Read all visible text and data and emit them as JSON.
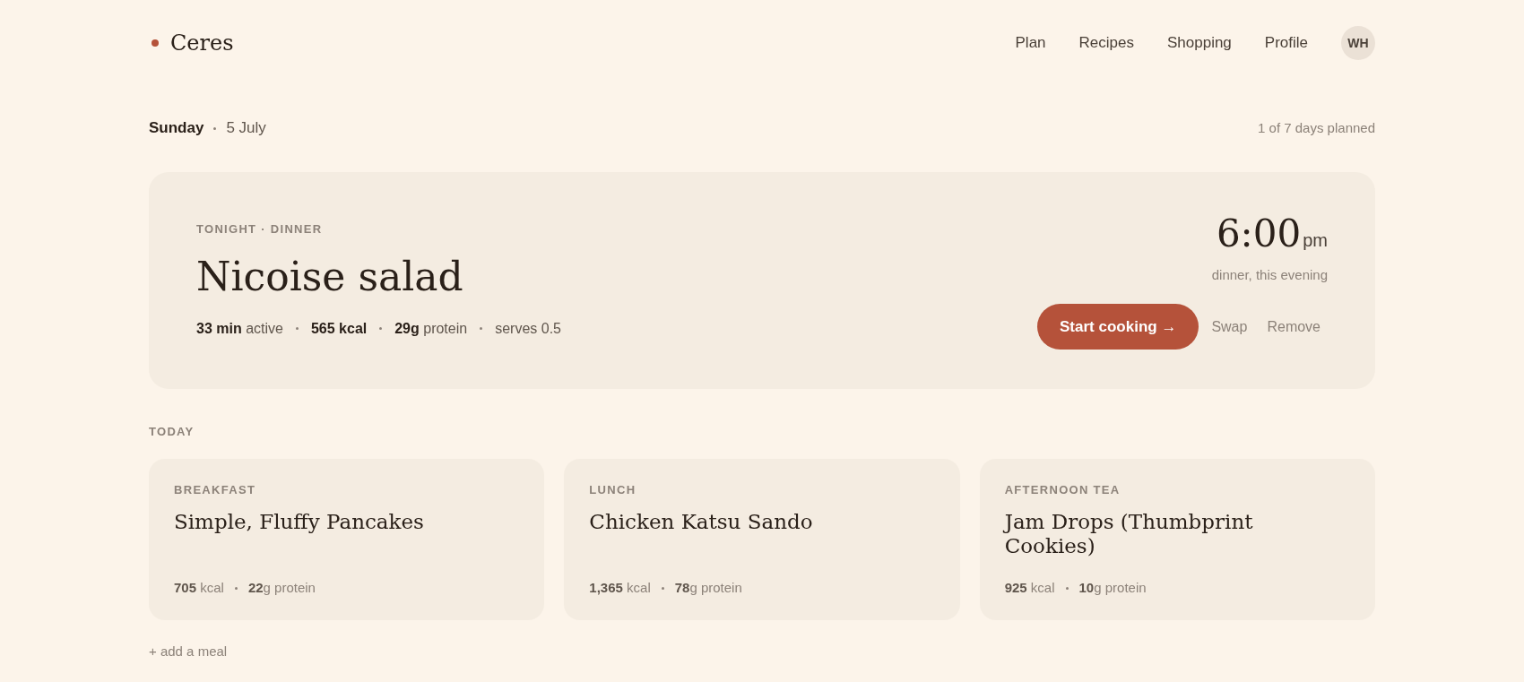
{
  "brand": {
    "name": "Ceres"
  },
  "nav": {
    "links": [
      "Plan",
      "Recipes",
      "Shopping",
      "Profile"
    ],
    "avatar": "WH"
  },
  "day": {
    "weekday": "Sunday",
    "date": "5 July",
    "progress": "1 of 7 days planned"
  },
  "tonight": {
    "eyebrow": "TONIGHT · DINNER",
    "title": "Nicoise salad",
    "stats": [
      "**33 min** active",
      "**565 kcal**",
      "**29g** protein",
      "serves 0.5"
    ],
    "time": "6:00",
    "period": "pm",
    "note": "dinner, this evening",
    "actions": [
      {
        "kind": "primary",
        "label": "Start cooking →"
      },
      {
        "kind": "text",
        "label": "Swap"
      },
      {
        "kind": "text",
        "label": "Remove"
      }
    ]
  },
  "today": {
    "label": "TODAY",
    "meals": [
      {
        "course": "BREAKFAST",
        "title": "Simple, Fluffy Pancakes",
        "stats": [
          "**705** kcal",
          "**22**g protein"
        ]
      },
      {
        "course": "LUNCH",
        "title": "Chicken Katsu Sando",
        "stats": [
          "**1,365** kcal",
          "**78**g protein"
        ]
      },
      {
        "course": "AFTERNOON TEA",
        "title": "Jam Drops (Thumbprint Cookies)",
        "stats": [
          "**925** kcal",
          "**10**g protein"
        ]
      }
    ],
    "add_meal": "+ add a meal"
  }
}
